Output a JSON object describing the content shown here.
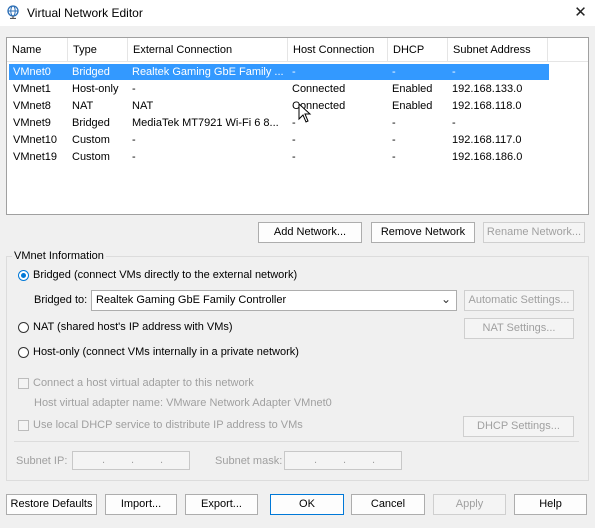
{
  "window": {
    "title": "Virtual Network Editor",
    "close_glyph": "✕",
    "icon": "globe-network-icon"
  },
  "table": {
    "columns": [
      "Name",
      "Type",
      "External Connection",
      "Host Connection",
      "DHCP",
      "Subnet Address"
    ],
    "rows": [
      {
        "name": "VMnet0",
        "type": "Bridged",
        "external": "Realtek Gaming GbE Family ...",
        "host": "-",
        "dhcp": "-",
        "subnet": "-"
      },
      {
        "name": "VMnet1",
        "type": "Host-only",
        "external": "-",
        "host": "Connected",
        "dhcp": "Enabled",
        "subnet": "192.168.133.0"
      },
      {
        "name": "VMnet8",
        "type": "NAT",
        "external": "NAT",
        "host": "Connected",
        "dhcp": "Enabled",
        "subnet": "192.168.118.0"
      },
      {
        "name": "VMnet9",
        "type": "Bridged",
        "external": "MediaTek MT7921 Wi-Fi 6 8...",
        "host": "-",
        "dhcp": "-",
        "subnet": "-"
      },
      {
        "name": "VMnet10",
        "type": "Custom",
        "external": "-",
        "host": "-",
        "dhcp": "-",
        "subnet": "192.168.117.0"
      },
      {
        "name": "VMnet19",
        "type": "Custom",
        "external": "-",
        "host": "-",
        "dhcp": "-",
        "subnet": "192.168.186.0"
      }
    ],
    "selected_row": "VMnet0"
  },
  "network_buttons": {
    "add": "Add Network...",
    "remove": "Remove Network",
    "rename": "Rename Network..."
  },
  "vmnet_info": {
    "title": "VMnet Information",
    "bridged_label": "Bridged (connect VMs directly to the external network)",
    "bridged_to_label": "Bridged to:",
    "bridged_to_value": "Realtek Gaming GbE Family Controller",
    "automatic_settings": "Automatic Settings...",
    "nat_label": "NAT (shared host's IP address with VMs)",
    "nat_settings": "NAT Settings...",
    "hostonly_label": "Host-only (connect VMs internally in a private network)",
    "connect_adapter_label": "Connect a host virtual adapter to this network",
    "adapter_name_label": "Host virtual adapter name: VMware Network Adapter VMnet0",
    "dhcp_label": "Use local DHCP service to distribute IP address to VMs",
    "dhcp_settings": "DHCP Settings...",
    "subnet_ip_label": "Subnet IP:",
    "subnet_mask_label": "Subnet mask:",
    "ip_dot": ".",
    "selected_mode": "Bridged"
  },
  "footer": {
    "restore": "Restore Defaults",
    "import": "Import...",
    "export": "Export...",
    "ok": "OK",
    "cancel": "Cancel",
    "apply": "Apply",
    "help": "Help"
  },
  "colors": {
    "selection": "#3399ff",
    "accent": "#0078d7"
  }
}
